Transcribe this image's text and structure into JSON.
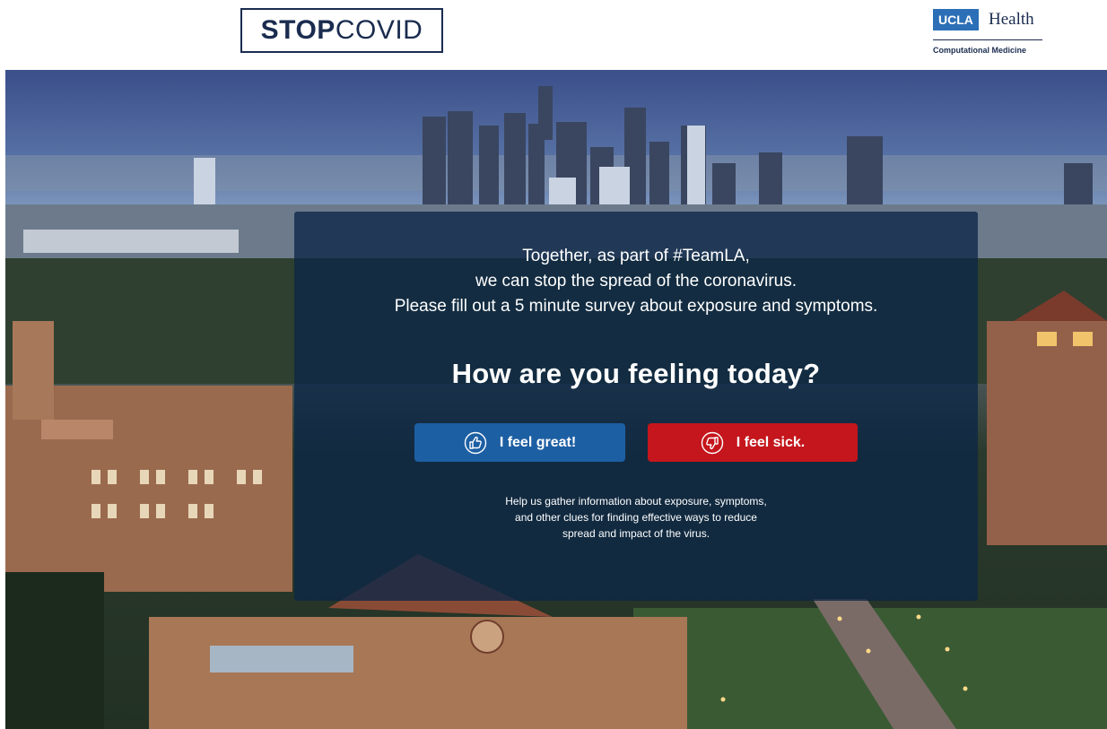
{
  "header": {
    "stop_logo": {
      "bold": "STOP",
      "light": "COVID"
    },
    "ucla_logo": {
      "badge": "UCLA",
      "name": "Health",
      "subtitle": "Computational Medicine"
    }
  },
  "hero": {
    "intro_lines": [
      "Together, as part of #TeamLA,",
      "we can stop the spread of the coronavirus.",
      "Please fill out a 5 minute survey about exposure and symptoms."
    ],
    "question": "How are you feeling today?",
    "buttons": {
      "great": {
        "label": "I feel great!",
        "icon": "thumbs-up-icon",
        "color": "#1d5fa3"
      },
      "sick": {
        "label": "I feel sick.",
        "icon": "thumbs-down-icon",
        "color": "#c4161c"
      }
    },
    "help_lines": [
      "Help us gather information about exposure, symptoms,",
      "and other clues for finding effective ways to reduce",
      "spread and impact of the virus."
    ]
  },
  "colors": {
    "brand_navy": "#1a2c4f",
    "ucla_blue": "#2c6fb6",
    "overlay": "#0b2646"
  }
}
